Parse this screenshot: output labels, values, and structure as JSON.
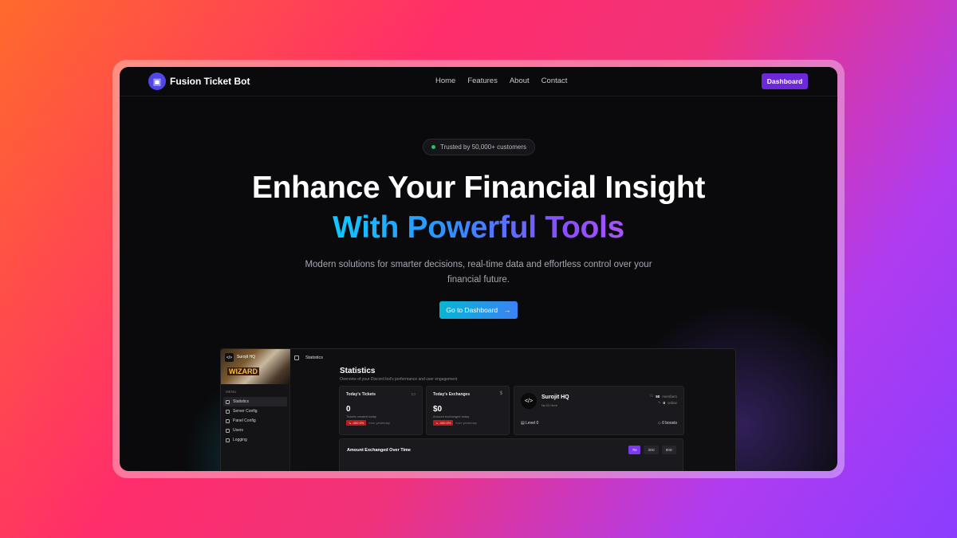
{
  "nav": {
    "brand": "Fusion Ticket Bot",
    "links": [
      "Home",
      "Features",
      "About",
      "Contact"
    ],
    "dashboard_label": "Dashboard"
  },
  "hero": {
    "pill": "Trusted by 50,000+ customers",
    "title_line1": "Enhance Your Financial Insight",
    "title_line2": "With Powerful Tools",
    "subtitle": "Modern solutions for smarter decisions, real-time data and effortless control over your financial future.",
    "cta": "Go to Dashboard",
    "cta_icon": "arrow-right-icon"
  },
  "app": {
    "banner_title": "Surojit HQ",
    "banner_word": "WIZARD",
    "topbar_title": "Statistics",
    "menu_label": "MENU",
    "menu": [
      "Statistics",
      "Server Config",
      "Panel Config",
      "Users",
      "Logging"
    ],
    "page_title": "Statistics",
    "page_sub": "Overview of your Discord bot's performance and user engagement",
    "tickets": {
      "title": "Today's Tickets",
      "value": "0",
      "sub": "Tickets created today",
      "badge": "↘ -400.0%",
      "from": "from yesterday"
    },
    "exchanges": {
      "title": "Today's Exchanges",
      "icon": "$",
      "value": "$0",
      "sub": "Amount exchanged today",
      "badge": "↘ -400.0%",
      "from": "from yesterday"
    },
    "server": {
      "name": "Surojit HQ",
      "sub": "No ID Here",
      "members_value": "50",
      "members_label": "members",
      "online_value": "0",
      "online_label": "online",
      "level": "Level 0",
      "boosts": "0 boosts"
    },
    "chart": {
      "title": "Amount Exchanged Over Time",
      "ranges": [
        "7D",
        "30D",
        "90D"
      ],
      "active": "7D"
    }
  }
}
